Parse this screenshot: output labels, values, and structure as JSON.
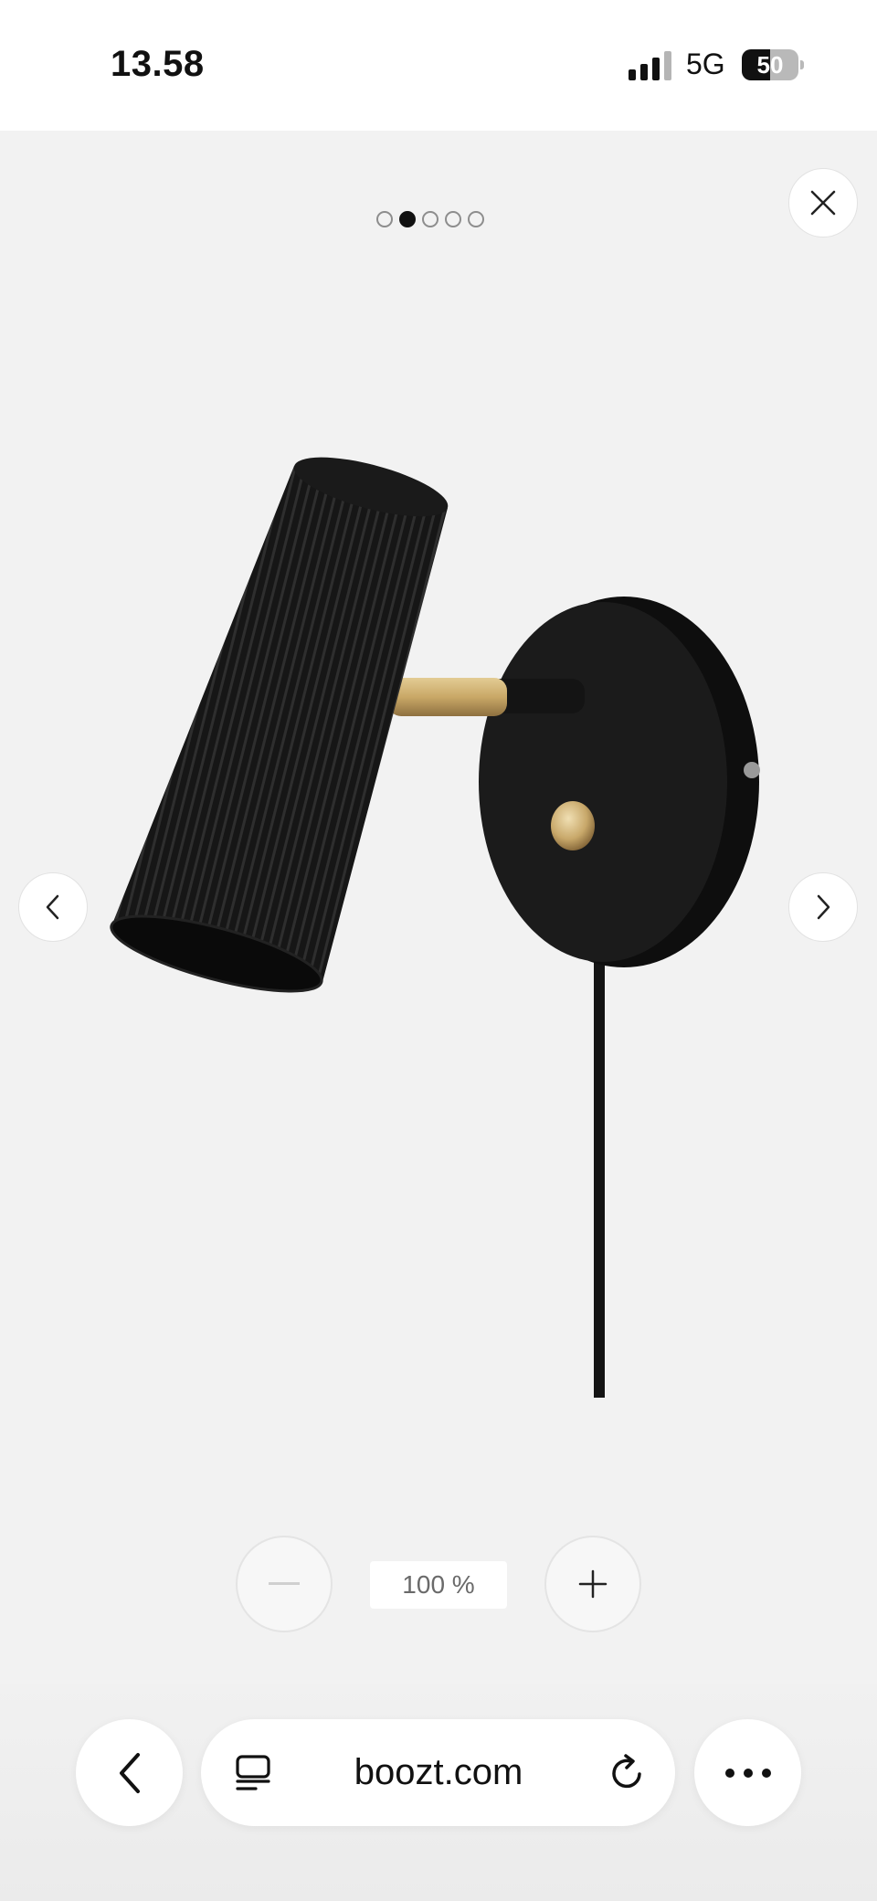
{
  "status_bar": {
    "time": "13.58",
    "network": "5G",
    "battery": "50",
    "battery_level": 0.5
  },
  "gallery": {
    "dots": [
      {
        "active": false
      },
      {
        "active": true
      },
      {
        "active": false
      },
      {
        "active": false
      },
      {
        "active": false
      }
    ],
    "close_icon": "close-icon",
    "prev_icon": "chevron-left-icon",
    "next_icon": "chevron-right-icon",
    "image": "black wall lamp with ribbed shade"
  },
  "zoom": {
    "level": "100 %",
    "minus_icon": "minus-icon",
    "plus_icon": "plus-icon"
  },
  "browser": {
    "url": "boozt.com",
    "back_icon": "back-chevron-icon",
    "tabs_icon": "tab-overview-icon",
    "reload_icon": "reload-icon",
    "more_icon": "more-icon"
  },
  "colors": {
    "background": "#f2f2f2",
    "lamp": "#151515",
    "brass": "#c9a867"
  }
}
